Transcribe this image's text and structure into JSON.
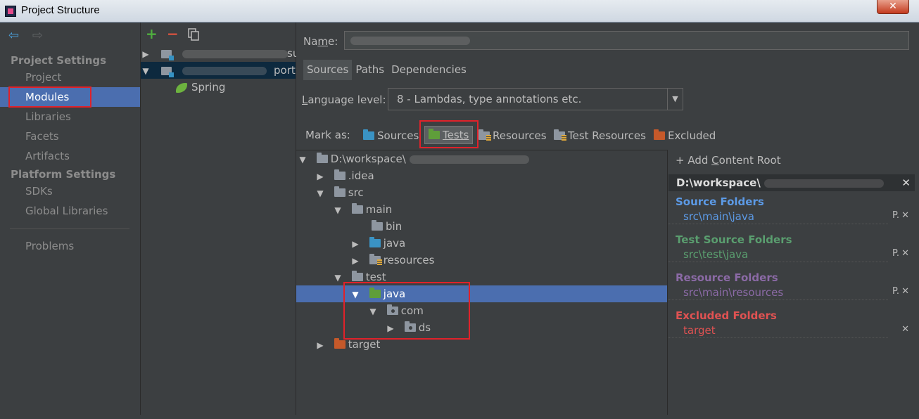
{
  "window": {
    "title": "Project Structure",
    "close_glyph": "✕"
  },
  "nav": {
    "back_glyph": "⇦",
    "forward_glyph": "⇨",
    "project_settings_header": "Project Settings",
    "project_settings": [
      "Project",
      "Modules",
      "Libraries",
      "Facets",
      "Artifacts"
    ],
    "platform_settings_header": "Platform Settings",
    "platform_settings": [
      "SDKs",
      "Global Libraries"
    ],
    "problems": "Problems",
    "selected": "Modules"
  },
  "modules": {
    "toolbar": {
      "add_glyph": "+",
      "remove_glyph": "−"
    },
    "items": [
      {
        "suffix": "su"
      },
      {
        "suffix": "port"
      }
    ],
    "facet": "Spring"
  },
  "editor": {
    "name_label": "Name:",
    "tabs": [
      "Sources",
      "Paths",
      "Dependencies"
    ],
    "selected_tab": "Sources",
    "language_level_label": "Language level:",
    "language_level_value": "8 - Lambdas, type annotations etc.",
    "mark_as_label": "Mark as:",
    "mark_as": [
      "Sources",
      "Tests",
      "Resources",
      "Test Resources",
      "Excluded"
    ]
  },
  "tree": {
    "root": "D:\\workspace\\",
    "nodes": [
      ".idea",
      "src",
      "main",
      "bin",
      "java",
      "resources",
      "test",
      "java",
      "com",
      "ds",
      "target"
    ],
    "selected": "test/java"
  },
  "content_root": {
    "add_label": "+ Add Content Root",
    "path": "D:\\workspace\\",
    "source_folders_label": "Source Folders",
    "source_folders": [
      "src\\main\\java"
    ],
    "test_source_folders_label": "Test Source Folders",
    "test_source_folders": [
      "src\\test\\java"
    ],
    "resource_folders_label": "Resource Folders",
    "resource_folders": [
      "src\\main\\resources"
    ],
    "excluded_folders_label": "Excluded Folders",
    "excluded_folders": [
      "target"
    ],
    "props_glyph": "P.",
    "remove_glyph": "✕"
  },
  "colors": {
    "selection": "#4b6eaf",
    "source": "#5c9ae6",
    "test": "#5a9e6f",
    "resource": "#8b6aa6",
    "excluded": "#e05252",
    "highlight_box": "#e0222a"
  }
}
